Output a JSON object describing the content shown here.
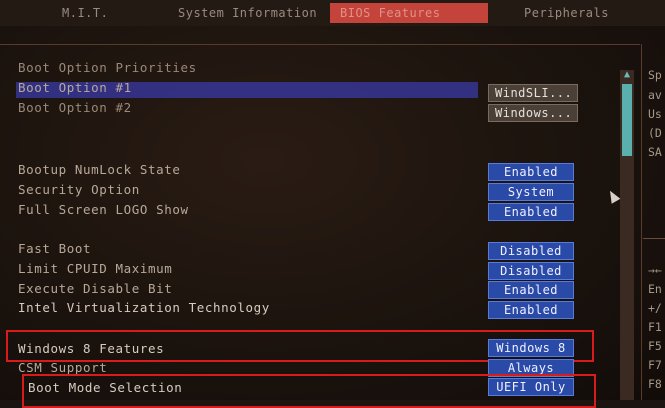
{
  "tabs": {
    "mit": "M.I.T.",
    "system_information": "System Information",
    "bios_features": "BIOS Features",
    "peripherals": "Peripherals"
  },
  "section_title": "Boot Option Priorities",
  "boot_options": [
    {
      "label": "Boot Option #1",
      "value": "WindSLI..."
    },
    {
      "label": "Boot Option #2",
      "value": "Windows..."
    }
  ],
  "settings": {
    "bootup_numlock": {
      "label": "Bootup NumLock State",
      "value": "Enabled"
    },
    "security_option": {
      "label": "Security Option",
      "value": "System"
    },
    "full_screen_logo": {
      "label": "Full Screen LOGO Show",
      "value": "Enabled"
    },
    "fast_boot": {
      "label": "Fast Boot",
      "value": "Disabled"
    },
    "limit_cpuid": {
      "label": "Limit CPUID Maximum",
      "value": "Disabled"
    },
    "execute_disable": {
      "label": "Execute Disable Bit",
      "value": "Enabled"
    },
    "intel_vt": {
      "label": "Intel Virtualization Technology",
      "value": "Enabled"
    },
    "windows8_features": {
      "label": "Windows 8 Features",
      "value": "Windows 8"
    },
    "csm_support": {
      "label": "CSM Support",
      "value": "Always"
    },
    "boot_mode": {
      "label": "Boot Mode Selection",
      "value": "UEFI Only"
    }
  },
  "right_panel": {
    "help": [
      "Sp",
      "av",
      "Us",
      "(D",
      "SA"
    ],
    "keys": [
      "→←",
      "En",
      "+/",
      "F1",
      "F5",
      "F7",
      "F8"
    ]
  },
  "colors": {
    "active_tab": "#c4443c",
    "value_box": "#2a4aa8",
    "highlight_box": "#d81c1c"
  }
}
